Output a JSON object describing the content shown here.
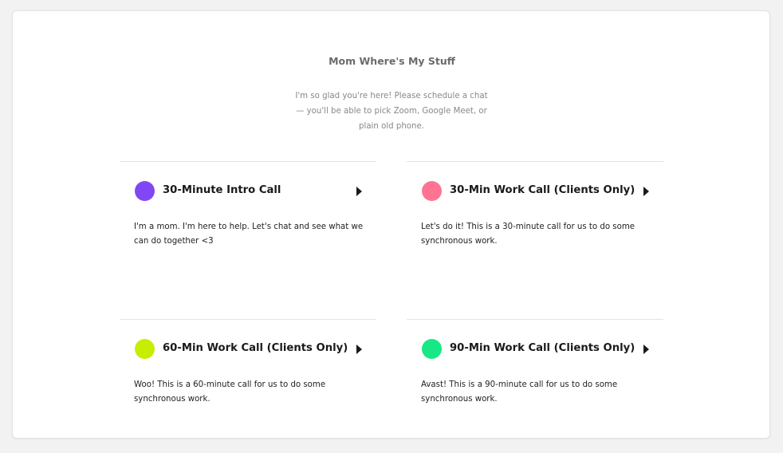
{
  "header": {
    "title": "Mom Where's My Stuff",
    "subtitle": "I'm so glad you're here! Please schedule a chat — you'll be able to pick Zoom, Google Meet, or plain old phone."
  },
  "events": [
    {
      "name": "30-Minute Intro Call",
      "description": "I'm a mom. I'm here to help. Let's chat and see what we can do together <3",
      "color": "#8247f5",
      "icon": "caret-right-icon"
    },
    {
      "name": "30-Min Work Call (Clients Only)",
      "description": "Let's do it! This is a 30-minute call for us to do some synchronous work.",
      "color": "#ff7591",
      "icon": "caret-right-icon"
    },
    {
      "name": "60-Min Work Call (Clients Only)",
      "description": "Woo! This is a 60-minute call for us to do some synchronous work.",
      "color": "#c9ed00",
      "icon": "caret-right-icon"
    },
    {
      "name": "90-Min Work Call (Clients Only)",
      "description": "Avast! This is a 90-minute call for us to do some synchronous work.",
      "color": "#17e885",
      "icon": "caret-right-icon"
    }
  ]
}
